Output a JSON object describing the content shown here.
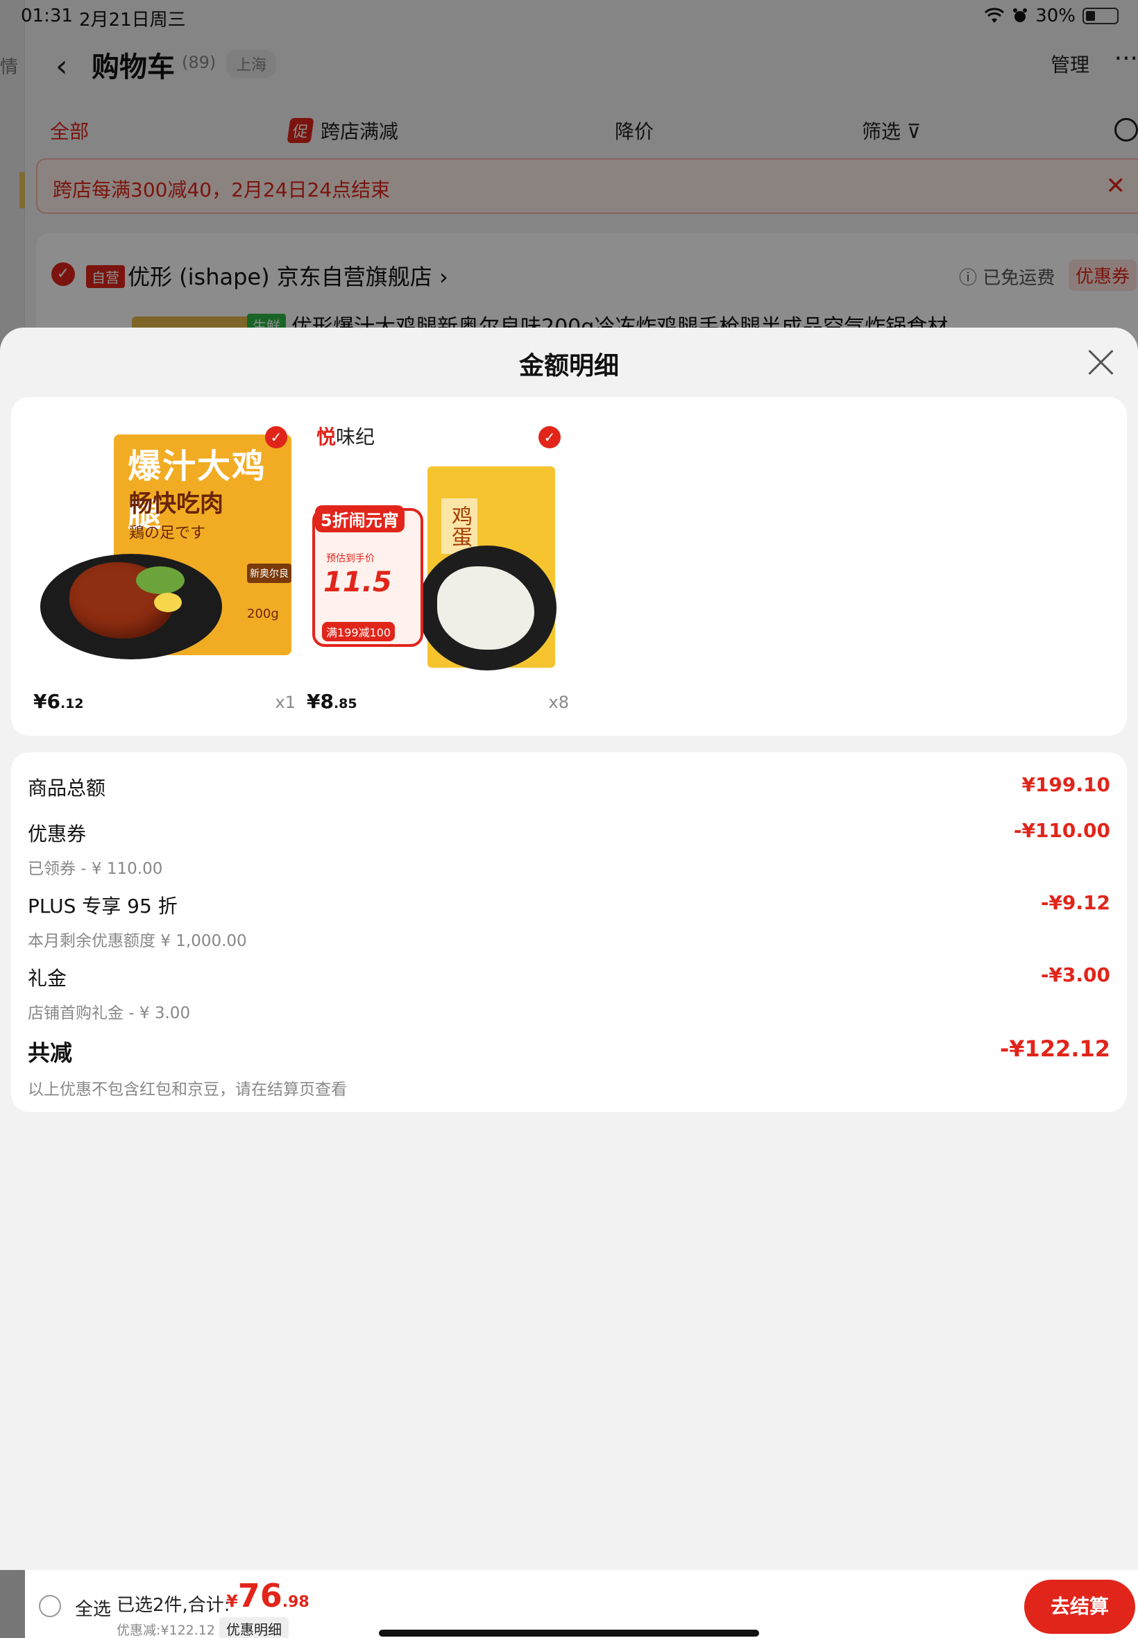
{
  "status_bar": {
    "time": "01:31",
    "date": "2月21日周三",
    "battery": "30%"
  },
  "background": {
    "left_strip_label": "情",
    "nav": {
      "title": "购物车",
      "count": "(89)",
      "location": "上海",
      "manage": "管理",
      "more": "···"
    },
    "filters": {
      "all": "全部",
      "promo_tag": "促",
      "cross_store": "跨店满减",
      "price_drop": "降价",
      "screen": "筛选"
    },
    "banner": "跨店每满300减40，2月24日24点结束",
    "store": {
      "self_tag": "自营",
      "name": "优形 (ishape) 京东自营旗舰店 ›",
      "shipping": "ⓘ 已免运费",
      "coupon": "优惠券",
      "fresh_tag": "生鲜",
      "product_title": "优形爆汁大鸡腿新奥尔良味200g冷冻炸鸡腿手枪腿半成品空气炸锅食材"
    }
  },
  "sheet": {
    "title": "金额明细",
    "products": [
      {
        "price_int": "¥6",
        "price_dec": ".12",
        "qty": "x1",
        "art": {
          "line1": "爆汁大鸡腿",
          "line2": "畅快吃肉",
          "line3": "鶏の足です",
          "badge": "新奥尔良",
          "weight": "200g"
        }
      },
      {
        "price_int": "¥8",
        "price_dec": ".85",
        "qty": "x8",
        "art": {
          "brand_mark": "悦",
          "brand_name": "味纪",
          "promo": "5折闹元宵",
          "label": "预估到手价",
          "value": "11.5",
          "deal": "满199减100",
          "bag_text": "鸡蛋"
        }
      }
    ],
    "details": {
      "goods_total": {
        "label": "商品总额",
        "amount": "¥199.10"
      },
      "coupon": {
        "label": "优惠券",
        "sub": "已领券 - ¥ 110.00",
        "amount": "-¥110.00"
      },
      "plus": {
        "label": "PLUS 专享 95 折",
        "sub": "本月剩余优惠额度 ¥ 1,000.00",
        "amount": "-¥9.12"
      },
      "gift": {
        "label": "礼金",
        "sub": "店铺首购礼金 - ¥ 3.00",
        "amount": "-¥3.00"
      },
      "total_discount": {
        "label": "共减",
        "sub": "以上优惠不包含红包和京豆，请在结算页查看",
        "amount": "-¥122.12"
      }
    }
  },
  "checkout": {
    "select_all": "全选",
    "selected": "已选2件,合计:",
    "total_currency": "¥",
    "total_int": "76",
    "total_dec": ".98",
    "saving": "优惠减:¥122.12",
    "detail_button": "优惠明细",
    "checkout_button": "去结算"
  },
  "colors": {
    "accent": "#e1251b",
    "sheet_bg": "#f2f2f2",
    "card_bg": "#ffffff"
  }
}
